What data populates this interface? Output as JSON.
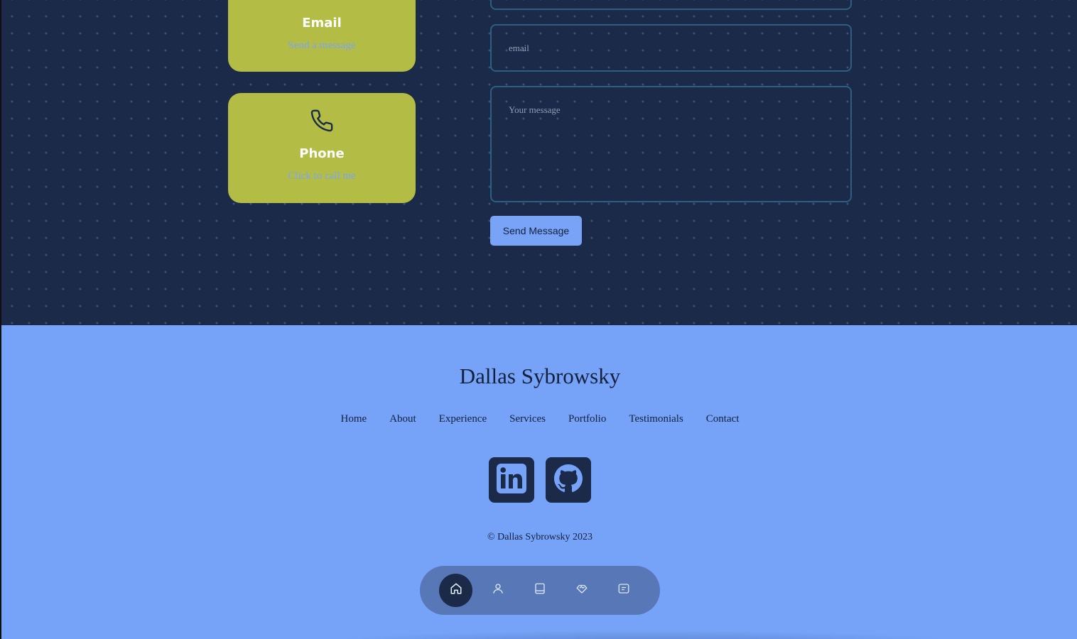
{
  "contact": {
    "email_card": {
      "title": "Email",
      "link": "Send a message"
    },
    "phone_card": {
      "title": "Phone",
      "link": "Click to call me"
    },
    "form": {
      "email_placeholder": "email",
      "message_placeholder": "Your message",
      "send_label": "Send Message"
    }
  },
  "footer": {
    "name": "Dallas Sybrowsky",
    "nav": [
      "Home",
      "About",
      "Experience",
      "Services",
      "Portfolio",
      "Testimonials",
      "Contact"
    ],
    "socials": [
      "linkedin-icon",
      "github-icon"
    ],
    "copyright": "© Dallas Sybrowsky 2023"
  },
  "bottom_nav": {
    "items": [
      "home-icon",
      "user-icon",
      "book-icon",
      "handshake-icon",
      "message-icon"
    ],
    "active": "home-icon"
  },
  "colors": {
    "section_bg": "#1a2a48",
    "card": "#b3bc45",
    "accent_blue": "#76a3f7",
    "link_blue": "#7aa6f8",
    "field_border": "#2d5f82",
    "nav_pill": "#5777b6",
    "dark_text": "#13213d"
  }
}
